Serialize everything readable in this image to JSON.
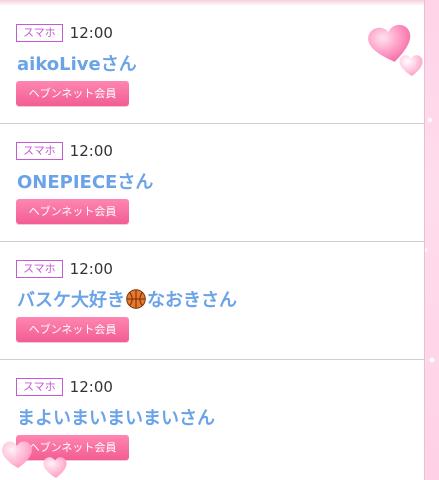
{
  "entries": [
    {
      "device": "スマホ",
      "time": "12:00",
      "name": "aikoLiveさん",
      "badge": "ヘブンネット会員"
    },
    {
      "device": "スマホ",
      "time": "12:00",
      "name": "ONEPIECEさん",
      "badge": "ヘブンネット会員"
    },
    {
      "device": "スマホ",
      "time": "12:00",
      "name_before_icon": "バスケ大好き",
      "name_icon": "basketball-icon",
      "name_after_icon": "なおきさん",
      "badge": "ヘブンネット会員"
    },
    {
      "device": "スマホ",
      "time": "12:00",
      "name": "まよいまいまいまいさん",
      "badge": "ヘブンネット会員"
    }
  ],
  "decorations": {
    "top_right": "hearts-icon",
    "bottom_left": "hearts-icon"
  },
  "colors": {
    "name_text": "#6aa3e8",
    "badge_bg": "#f25d93",
    "device_border": "#c65ad6",
    "frame_bg": "#ffd3e8"
  }
}
